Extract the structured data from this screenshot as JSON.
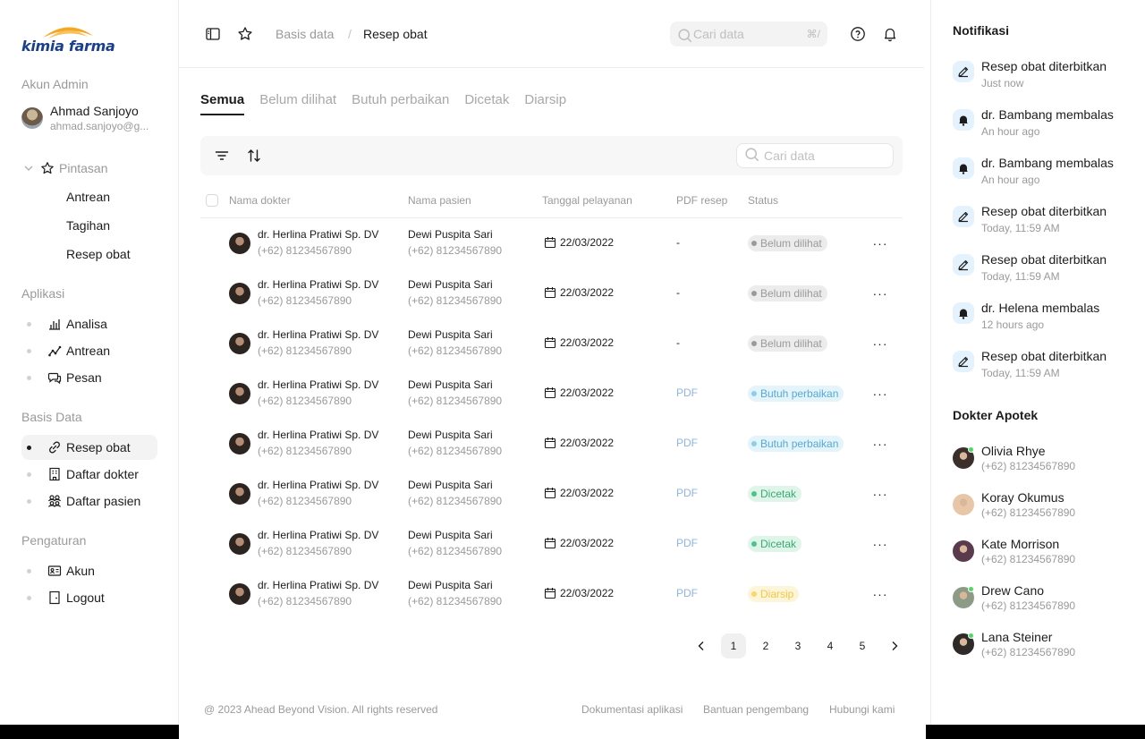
{
  "brand": {
    "logo_text": "kimia farma",
    "colors": {
      "primary": "#1a3f8f",
      "accent": "#f5a623"
    }
  },
  "sidebar": {
    "account_label": "Akun Admin",
    "user": {
      "name": "Ahmad Sanjoyo",
      "email": "ahmad.sanjoyo@g..."
    },
    "shortcuts": {
      "label": "Pintasan",
      "icon": "star-icon",
      "items": [
        "Antrean",
        "Tagihan",
        "Resep obat"
      ]
    },
    "apps": {
      "label": "Aplikasi",
      "items": [
        {
          "label": "Analisa",
          "icon": "bar-chart-icon"
        },
        {
          "label": "Antrean",
          "icon": "line-chart-icon"
        },
        {
          "label": "Pesan",
          "icon": "chat-icon"
        }
      ]
    },
    "database": {
      "label": "Basis Data",
      "items": [
        {
          "label": "Resep obat",
          "icon": "link-icon",
          "active": true
        },
        {
          "label": "Daftar dokter",
          "icon": "building-icon"
        },
        {
          "label": "Daftar pasien",
          "icon": "users-icon"
        }
      ]
    },
    "settings": {
      "label": "Pengaturan",
      "items": [
        {
          "label": "Akun",
          "icon": "id-card-icon"
        },
        {
          "label": "Logout",
          "icon": "logout-icon"
        }
      ]
    }
  },
  "topbar": {
    "breadcrumb": [
      "Basis data",
      "Resep obat"
    ],
    "breadcrumb_sep": "/",
    "search_placeholder": "Cari data",
    "search_shortcut": "⌘/"
  },
  "tabs": [
    "Semua",
    "Belum dilihat",
    "Butuh perbaikan",
    "Dicetak",
    "Diarsip"
  ],
  "active_tab": "Semua",
  "table": {
    "search_placeholder": "Cari data",
    "columns": [
      "Nama dokter",
      "Nama pasien",
      "Tanggal pelayanan",
      "PDF resep",
      "Status"
    ],
    "rows": [
      {
        "doctor": "dr. Herlina Pratiwi Sp. DV",
        "doctor_phone": "(+62) 81234567890",
        "patient": "Dewi Puspita Sari",
        "patient_phone": "(+62) 81234567890",
        "date": "22/03/2022",
        "pdf": "-",
        "status": "Belum dilihat",
        "status_kind": "unseen"
      },
      {
        "doctor": "dr. Herlina Pratiwi Sp. DV",
        "doctor_phone": "(+62) 81234567890",
        "patient": "Dewi Puspita Sari",
        "patient_phone": "(+62) 81234567890",
        "date": "22/03/2022",
        "pdf": "-",
        "status": "Belum dilihat",
        "status_kind": "unseen"
      },
      {
        "doctor": "dr. Herlina Pratiwi Sp. DV",
        "doctor_phone": "(+62) 81234567890",
        "patient": "Dewi Puspita Sari",
        "patient_phone": "(+62) 81234567890",
        "date": "22/03/2022",
        "pdf": "-",
        "status": "Belum dilihat",
        "status_kind": "unseen"
      },
      {
        "doctor": "dr. Herlina Pratiwi Sp. DV",
        "doctor_phone": "(+62) 81234567890",
        "patient": "Dewi Puspita Sari",
        "patient_phone": "(+62) 81234567890",
        "date": "22/03/2022",
        "pdf": "PDF",
        "status": "Butuh perbaikan",
        "status_kind": "fix"
      },
      {
        "doctor": "dr. Herlina Pratiwi Sp. DV",
        "doctor_phone": "(+62) 81234567890",
        "patient": "Dewi Puspita Sari",
        "patient_phone": "(+62) 81234567890",
        "date": "22/03/2022",
        "pdf": "PDF",
        "status": "Butuh perbaikan",
        "status_kind": "fix"
      },
      {
        "doctor": "dr. Herlina Pratiwi Sp. DV",
        "doctor_phone": "(+62) 81234567890",
        "patient": "Dewi Puspita Sari",
        "patient_phone": "(+62) 81234567890",
        "date": "22/03/2022",
        "pdf": "PDF",
        "status": "Dicetak",
        "status_kind": "printed"
      },
      {
        "doctor": "dr. Herlina Pratiwi Sp. DV",
        "doctor_phone": "(+62) 81234567890",
        "patient": "Dewi Puspita Sari",
        "patient_phone": "(+62) 81234567890",
        "date": "22/03/2022",
        "pdf": "PDF",
        "status": "Dicetak",
        "status_kind": "printed"
      },
      {
        "doctor": "dr. Herlina Pratiwi Sp. DV",
        "doctor_phone": "(+62) 81234567890",
        "patient": "Dewi Puspita Sari",
        "patient_phone": "(+62) 81234567890",
        "date": "22/03/2022",
        "pdf": "PDF",
        "status": "Diarsip",
        "status_kind": "archived"
      }
    ],
    "status_colors": {
      "unseen": {
        "bg": "#ececec",
        "text": "#9a9a9a",
        "dot": "#9a9a9a"
      },
      "fix": {
        "bg": "#e3f4fb",
        "text": "#59a8d4",
        "dot": "#8fcdea"
      },
      "printed": {
        "bg": "#e0f5ea",
        "text": "#3aa873",
        "dot": "#4cc38a"
      },
      "archived": {
        "bg": "#fdf5d8",
        "text": "#f0c84a",
        "dot": "#f5d76e"
      }
    },
    "pdf_link_color": "#8fb4e8"
  },
  "pagination": {
    "pages": [
      "1",
      "2",
      "3",
      "4",
      "5"
    ],
    "current": "1"
  },
  "footer": {
    "copyright": "@ 2023 Ahead Beyond Vision. All rights reserved",
    "links": [
      "Dokumentasi aplikasi",
      "Bantuan pengembang",
      "Hubungi kami"
    ]
  },
  "notifications": {
    "title": "Notifikasi",
    "items": [
      {
        "text": "Resep obat diterbitkan",
        "time": "Just now",
        "icon": "edit-icon"
      },
      {
        "text": "dr. Bambang membalas",
        "time": "An hour ago",
        "icon": "bell-icon"
      },
      {
        "text": "dr. Bambang membalas",
        "time": "An hour ago",
        "icon": "bell-icon"
      },
      {
        "text": "Resep obat diterbitkan",
        "time": "Today, 11:59 AM",
        "icon": "edit-icon"
      },
      {
        "text": "Resep obat diterbitkan",
        "time": "Today, 11:59 AM",
        "icon": "edit-icon"
      },
      {
        "text": "dr. Helena membalas",
        "time": "12 hours ago",
        "icon": "bell-icon"
      },
      {
        "text": "Resep obat diterbitkan",
        "time": "Today, 11:59 AM",
        "icon": "edit-icon"
      }
    ]
  },
  "doctors": {
    "title": "Dokter Apotek",
    "items": [
      {
        "name": "Olivia Rhye",
        "phone": "(+62) 81234567890",
        "online": true,
        "avatar_color": "#3a2f2a"
      },
      {
        "name": "Koray Okumus",
        "phone": "(+62) 81234567890",
        "online": false,
        "avatar_color": "#e8c7a8"
      },
      {
        "name": "Kate Morrison",
        "phone": "(+62) 81234567890",
        "online": false,
        "avatar_color": "#5a3b4d"
      },
      {
        "name": "Drew Cano",
        "phone": "(+62) 81234567890",
        "online": true,
        "avatar_color": "#8d9a86"
      },
      {
        "name": "Lana Steiner",
        "phone": "(+62) 81234567890",
        "online": true,
        "avatar_color": "#2e2a28"
      }
    ]
  }
}
